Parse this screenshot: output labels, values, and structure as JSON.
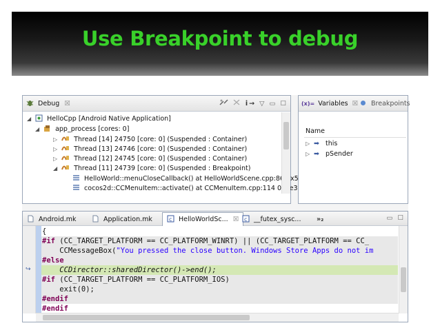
{
  "slide": {
    "title": "Use Breakpoint to debug"
  },
  "debug_view": {
    "tab_label": "Debug",
    "tab_close": "☒",
    "toolbar": {
      "step_into": "i→",
      "menu": "▽",
      "minimize": "▭",
      "maximize": "☐"
    },
    "items": [
      {
        "label": "HelloCpp [Android Native Application]",
        "expand": "◢"
      },
      {
        "label": "app_process [cores: 0]",
        "expand": "◢"
      },
      {
        "label": "Thread [14] 24750 [core: 0] (Suspended : Container)",
        "expand": "▷"
      },
      {
        "label": "Thread [13] 24746 [core: 0] (Suspended : Container)",
        "expand": "▷"
      },
      {
        "label": "Thread [12] 24745 [core: 0] (Suspended : Container)",
        "expand": "▷"
      },
      {
        "label": "Thread [11] 24739 [core: 0] (Suspended : Breakpoint)",
        "expand": "◢"
      },
      {
        "label": "HelloWorld::menuCloseCallback() at HelloWorldScene.cpp:86 0x5",
        "expand": ""
      },
      {
        "label": "cocos2d::CCMenuItem::activate() at CCMenuItem.cpp:114 0x5e3",
        "expand": ""
      }
    ]
  },
  "variables_view": {
    "tab_label": "Variables",
    "tab_close": "☒",
    "tab2_label": "Breakpoints",
    "column_header": "Name",
    "rows": [
      {
        "name": "this",
        "expand": "▷"
      },
      {
        "name": "pSender",
        "expand": "▷"
      }
    ]
  },
  "editor": {
    "tabs": [
      {
        "label": "Android.mk"
      },
      {
        "label": "Application.mk"
      },
      {
        "label": "HelloWorldSc...",
        "close": "☒"
      },
      {
        "label": "__futex_sysc..."
      }
    ],
    "overflow": "»₂",
    "lines": [
      {
        "parts": [
          "{"
        ]
      },
      {
        "parts": [
          "#if",
          " (CC_TARGET_PLATFORM == CC_PLATFORM_WINRT) || (CC_TARGET_PLATFORM == CC_"
        ]
      },
      {
        "parts": [
          "    CCMessageBox(",
          "\"You pressed the close button. Windows Store Apps do not im"
        ]
      },
      {
        "parts": [
          "#else"
        ]
      },
      {
        "parts": [
          "    CCDirector::sharedDirector()->end();"
        ]
      },
      {
        "parts": [
          "#if",
          " (CC_TARGET_PLATFORM == CC_PLATFORM_IOS)"
        ]
      },
      {
        "parts": [
          "    exit(0);"
        ]
      },
      {
        "parts": [
          "#endif"
        ]
      },
      {
        "parts": [
          "#endif"
        ]
      }
    ]
  },
  "colors": {
    "title_green": "#39d12a",
    "current_line": "#d4e8b4",
    "inactive_code_bg": "#e8e8e8"
  }
}
